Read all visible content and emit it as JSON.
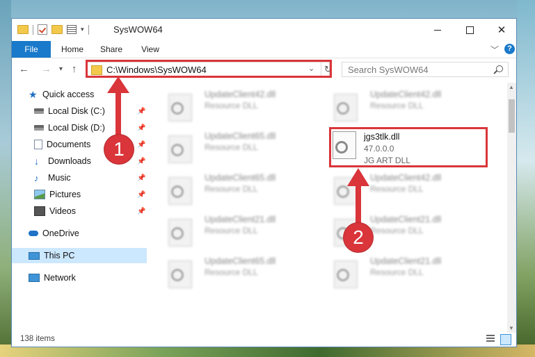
{
  "window": {
    "title": "SysWOW64",
    "controls": {
      "minimize": "—",
      "maximize": "☐",
      "close": "✕"
    }
  },
  "ribbon": {
    "tabs": [
      "File",
      "Home",
      "Share",
      "View"
    ],
    "help": "?"
  },
  "navigation": {
    "address": "C:\\Windows\\SysWOW64",
    "search_placeholder": "Search SysWOW64"
  },
  "sidebar": {
    "items": [
      {
        "label": "Quick access",
        "icon": "star-icon"
      },
      {
        "label": "Local Disk (C:)",
        "icon": "disk-icon",
        "pinned": true
      },
      {
        "label": "Local Disk (D:)",
        "icon": "disk-icon",
        "pinned": true
      },
      {
        "label": "Documents",
        "icon": "documents-icon",
        "pinned": true
      },
      {
        "label": "Downloads",
        "icon": "download-icon",
        "pinned": true
      },
      {
        "label": "Music",
        "icon": "music-icon",
        "pinned": true
      },
      {
        "label": "Pictures",
        "icon": "pictures-icon",
        "pinned": true
      },
      {
        "label": "Videos",
        "icon": "videos-icon",
        "pinned": true
      },
      {
        "label": "OneDrive",
        "icon": "cloud-icon"
      },
      {
        "label": "This PC",
        "icon": "pc-icon",
        "selected": true
      },
      {
        "label": "Network",
        "icon": "network-icon"
      }
    ]
  },
  "files": [
    {
      "name": "UpdateClient42.dll",
      "type": "Resource DLL"
    },
    {
      "name": "UpdateClient42.dll",
      "type": "Resource DLL"
    },
    {
      "name": "UpdateClient65.dll",
      "type": "Resource DLL"
    },
    {
      "name": "jgs3tlk.dll",
      "version": "47.0.0.0",
      "type": "JG ART DLL"
    },
    {
      "name": "UpdateClient65.dll",
      "type": "Resource DLL"
    },
    {
      "name": "UpdateClient42.dll",
      "type": "Resource DLL"
    },
    {
      "name": "UpdateClient21.dll",
      "type": "Resource DLL"
    },
    {
      "name": "UpdateClient21.dll",
      "type": "Resource DLL"
    },
    {
      "name": "UpdateClient65.dll",
      "type": "Resource DLL"
    },
    {
      "name": "UpdateClient21.dll",
      "type": "Resource DLL"
    }
  ],
  "status": {
    "item_count": "138 items"
  },
  "callouts": [
    "1",
    "2"
  ],
  "colors": {
    "accent": "#1979ca",
    "highlight": "#d9353a",
    "selected": "#cce8ff"
  }
}
